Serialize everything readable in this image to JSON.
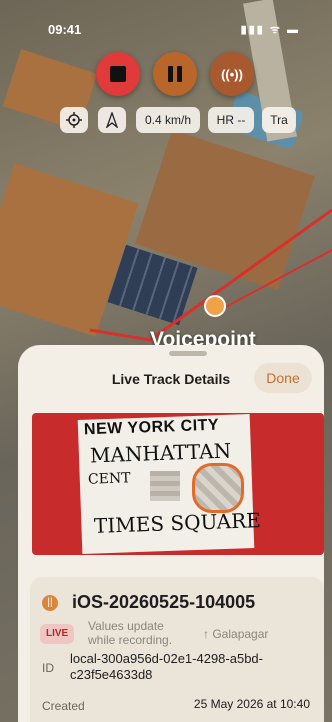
{
  "status_bar": {
    "time": "09:41",
    "indicators": "▮▮▮ ᯤ ▬"
  },
  "controls": {
    "stop_icon": "stop-square-icon",
    "pause_icon": "pause-icon",
    "broadcast_icon": "broadcast-waves-icon",
    "broadcast_label": "((•))"
  },
  "chips": {
    "speed": "0.4 km/h",
    "heart_rate": "HR --",
    "tracking": "Tra"
  },
  "map_label": "Voicepoint",
  "sheet": {
    "title": "Live Track Details",
    "done_label": "Done",
    "photo_text": {
      "line1": "NEW YORK CITY",
      "line2": "MANHATTAN",
      "line3": "CENT",
      "line4": "TIMES SQUARE"
    },
    "track": {
      "name": "iOS-20260525-104005",
      "live_badge": "LIVE",
      "hint": "Values update while recording.",
      "location": "Galapagar",
      "id_label": "ID",
      "id_value": "local-300a956d-02e1-4298-a5bd-c23f5e4633d8",
      "created_label": "Created",
      "created_value": "25 May 2026 at 10:40"
    }
  },
  "colors": {
    "stop": "#e03a3a",
    "pause": "#b8662a",
    "accent": "#c07038",
    "live_bg": "#efc6c2"
  }
}
